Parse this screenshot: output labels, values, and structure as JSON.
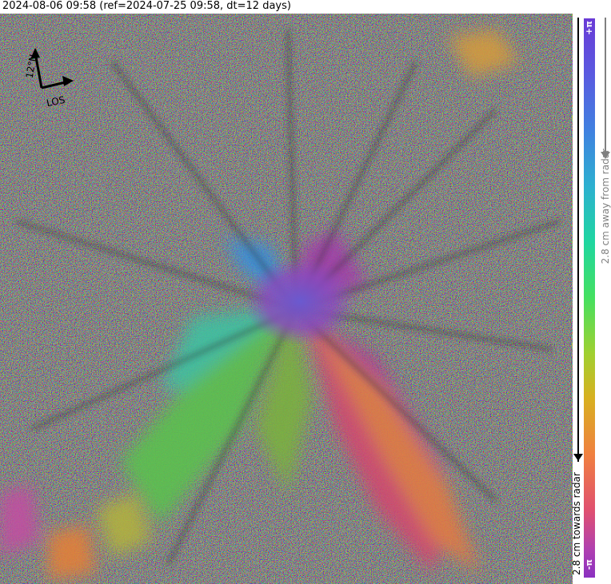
{
  "header": {
    "title": "2024-08-06 09:58 (ref=2024-07-25 09:58, dt=12 days)"
  },
  "compass": {
    "north_label": "12°N",
    "los_label": "LOS"
  },
  "colorbar": {
    "top_label": "+π",
    "bottom_label": "-π",
    "away_label": "2.8 cm away from radar",
    "towards_label": "2.8 cm towards radar"
  }
}
